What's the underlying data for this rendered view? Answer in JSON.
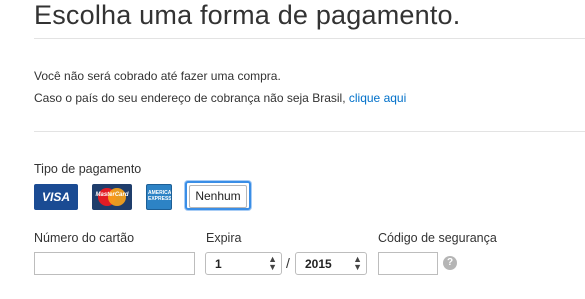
{
  "page": {
    "title": "Escolha uma forma de pagamento."
  },
  "notice": {
    "line1": "Você não será cobrado até fazer uma compra.",
    "line2_prefix": "Caso o país do seu endereço de cobrança não seja Brasil, ",
    "line2_link": "clique aqui"
  },
  "payment_type": {
    "label": "Tipo de pagamento",
    "cards": [
      {
        "name": "Visa",
        "text": "VISA",
        "icon": "visa-card-icon"
      },
      {
        "name": "MasterCard",
        "text": "MasterCard",
        "icon": "mastercard-card-icon"
      },
      {
        "name": "American Express",
        "text": "AMERICAN EXPRESS",
        "icon": "amex-card-icon"
      }
    ],
    "none_label": "Nenhum"
  },
  "card_number": {
    "label": "Número do cartão",
    "value": ""
  },
  "expiry": {
    "label": "Expira",
    "month": "1",
    "year": "2015",
    "separator": "/"
  },
  "security_code": {
    "label": "Código de segurança",
    "value": "",
    "help_icon": "help-icon",
    "help_glyph": "?"
  },
  "colors": {
    "link": "#0070c9",
    "selected_border": "#3a8ee6"
  }
}
